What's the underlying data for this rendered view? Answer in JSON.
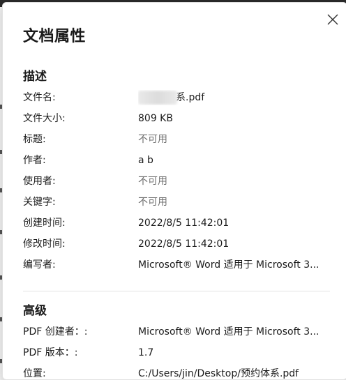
{
  "dialog": {
    "title": "文档属性"
  },
  "description": {
    "heading": "描述",
    "rows": [
      {
        "label": "文件名:",
        "value": "系.pdf",
        "muted": false,
        "blurred_prefix": true
      },
      {
        "label": "文件大小:",
        "value": "809 KB",
        "muted": false
      },
      {
        "label": "标题:",
        "value": "不可用",
        "muted": true
      },
      {
        "label": "作者:",
        "value": "a b",
        "muted": false
      },
      {
        "label": "使用者:",
        "value": "不可用",
        "muted": true
      },
      {
        "label": "关键字:",
        "value": "不可用",
        "muted": true
      },
      {
        "label": "创建时间:",
        "value": "2022/8/5 11:42:01",
        "muted": false
      },
      {
        "label": "修改时间:",
        "value": "2022/8/5 11:42:01",
        "muted": false
      },
      {
        "label": "编写者:",
        "value": "Microsoft® Word 适用于 Microsoft 3...",
        "muted": false
      }
    ]
  },
  "advanced": {
    "heading": "高级",
    "rows": [
      {
        "label": "PDF 创建者：:",
        "value": "Microsoft® Word 适用于 Microsoft 3...",
        "muted": false
      },
      {
        "label": "PDF 版本：:",
        "value": "1.7",
        "muted": false
      },
      {
        "label": "位置:",
        "value": "C:/Users/jin/Desktop/预约体系.pdf",
        "muted": false
      }
    ]
  },
  "icons": {
    "close": "close-icon"
  }
}
